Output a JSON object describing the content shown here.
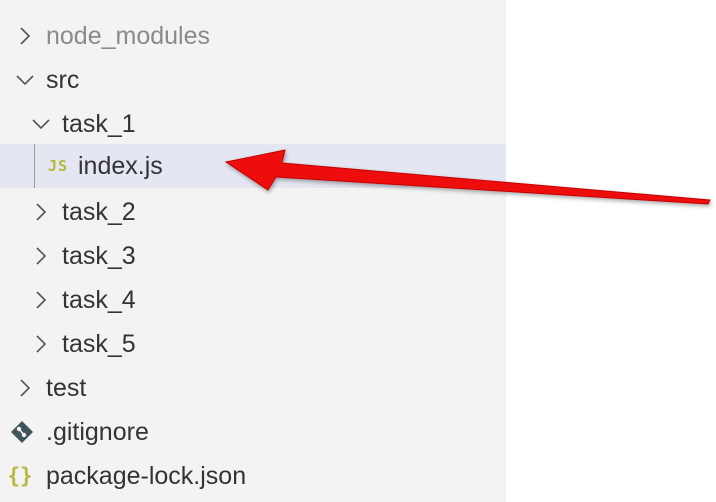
{
  "tree": {
    "items": [
      {
        "label": "node_modules",
        "icon": "chevron-right-icon"
      },
      {
        "label": "src",
        "icon": "chevron-down-icon"
      },
      {
        "label": "task_1",
        "icon": "chevron-down-icon"
      },
      {
        "label": "index.js",
        "icon": "js-file-icon",
        "icon_text": "JS"
      },
      {
        "label": "task_2",
        "icon": "chevron-right-icon"
      },
      {
        "label": "task_3",
        "icon": "chevron-right-icon"
      },
      {
        "label": "task_4",
        "icon": "chevron-right-icon"
      },
      {
        "label": "task_5",
        "icon": "chevron-right-icon"
      },
      {
        "label": "test",
        "icon": "chevron-right-icon"
      },
      {
        "label": ".gitignore",
        "icon": "git-file-icon"
      },
      {
        "label": "package-lock.json",
        "icon": "json-file-icon",
        "icon_text": "{}"
      }
    ]
  },
  "colors": {
    "sidebar_bg": "#f3f3f3",
    "selected_bg": "#e4e6f1",
    "dim_text": "#8a8a8a",
    "arrow": "#e81212",
    "js_icon": "#b7b73b"
  }
}
